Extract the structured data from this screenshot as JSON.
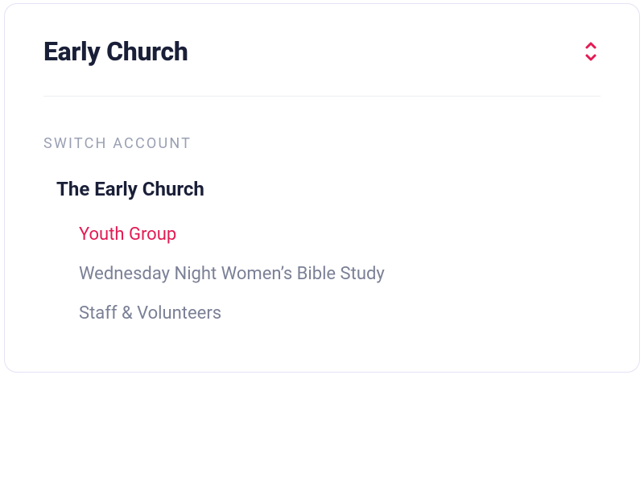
{
  "header": {
    "title": "Early Church"
  },
  "section": {
    "label": "Switch Account"
  },
  "accounts": {
    "primary": "The Early Church",
    "subs": [
      {
        "name": "Youth Group",
        "active": true
      },
      {
        "name": "Wednesday Night Women’s Bible Study",
        "active": false
      },
      {
        "name": "Staff & Volunteers",
        "active": false
      }
    ]
  },
  "colors": {
    "accent": "#e31b54",
    "text_dark": "#1a1f38",
    "text_muted": "#7b8096",
    "border": "#e5e1f5"
  }
}
